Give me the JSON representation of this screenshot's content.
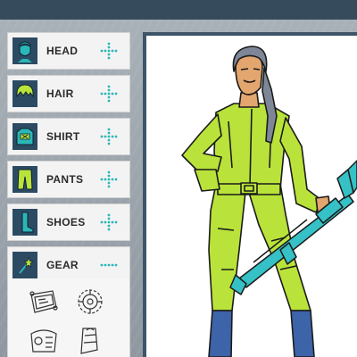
{
  "categories": [
    {
      "label": "HEAD",
      "icon": "head-icon"
    },
    {
      "label": "HAIR",
      "icon": "hair-icon"
    },
    {
      "label": "SHIRT",
      "icon": "shirt-icon"
    },
    {
      "label": "PANTS",
      "icon": "pants-icon"
    },
    {
      "label": "SHOES",
      "icon": "shoes-icon"
    },
    {
      "label": "GEAR",
      "icon": "gear-wand-icon",
      "active": true
    }
  ],
  "gear_items": [
    "belt-pouch-icon",
    "round-mechanism-icon",
    "wrist-device-icon",
    "boot-armor-icon"
  ],
  "colors": {
    "accent_teal": "#2bb6b8",
    "thumbnail_bg": "#2c4b63",
    "suit_green": "#b9e33a",
    "boot_blue": "#3d63a8",
    "weapon_teal": "#35c1c6",
    "hair_gray": "#7d8797",
    "topbar": "#364b5c"
  }
}
